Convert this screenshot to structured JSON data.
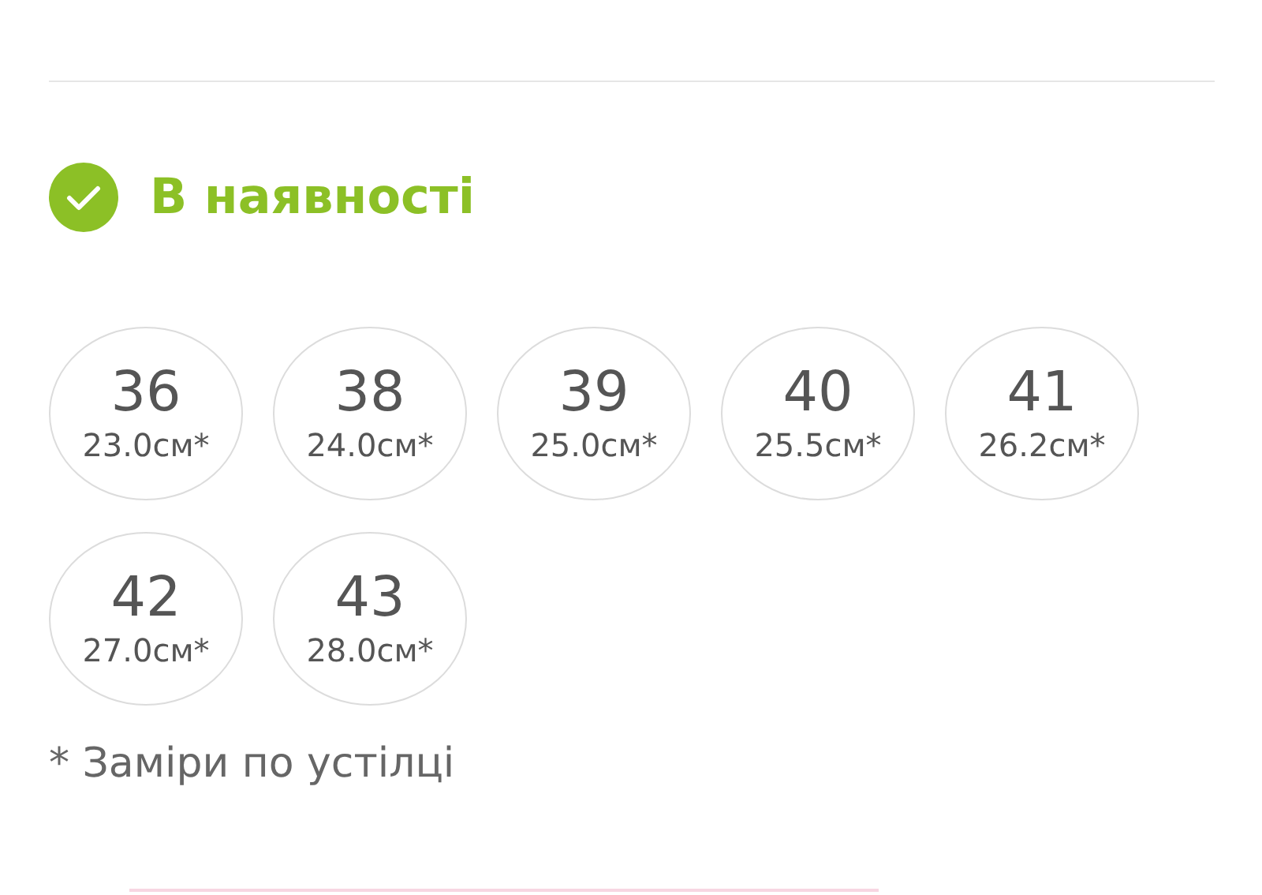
{
  "availability": {
    "label": "В наявності",
    "in_stock": true
  },
  "sizes": [
    {
      "size": "36",
      "length": "23.0см*"
    },
    {
      "size": "38",
      "length": "24.0см*"
    },
    {
      "size": "39",
      "length": "25.0см*"
    },
    {
      "size": "40",
      "length": "25.5см*"
    },
    {
      "size": "41",
      "length": "26.2см*"
    },
    {
      "size": "42",
      "length": "27.0см*"
    },
    {
      "size": "43",
      "length": "28.0см*"
    }
  ],
  "footnote": "* Заміри по устілці"
}
